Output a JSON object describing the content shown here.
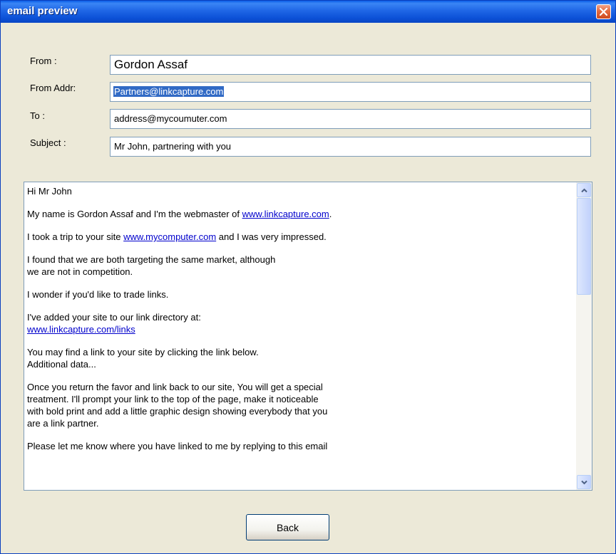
{
  "window": {
    "title": "email preview"
  },
  "form": {
    "from_label": "From :",
    "from_value": "Gordon Assaf",
    "from_addr_label": "From Addr:",
    "from_addr_value": "Partners@linkcapture.com",
    "to_label": "To :",
    "to_value": "address@mycoumuter.com",
    "subject_label": "Subject :",
    "subject_value": "Mr John, partnering with you"
  },
  "body": {
    "greeting": "Hi Mr John",
    "p1_before": "My name is Gordon Assaf and I'm the webmaster of ",
    "p1_link": "www.linkcapture.com",
    "p1_after": ".",
    "p2_before": "I took a trip to your site ",
    "p2_link": "www.mycomputer.com",
    "p2_after": " and I was very impressed.",
    "p3": "I found that we are both targeting the same market, although\nwe are not in competition.",
    "p4": "I wonder if you'd like to trade links.",
    "p5_text": "I've added your site to our link directory at:",
    "p5_link": "www.linkcapture.com/links",
    "p6": "You may find a link to your site by clicking the link below.\nAdditional data...",
    "p7": "Once you return the favor and link back to our site, You will get a special\ntreatment.  I'll prompt your link to the top of the page, make it noticeable\nwith bold print and add a little graphic design showing everybody that you\nare a link partner.",
    "p8": "Please let me know where you have linked to me by replying to this email"
  },
  "buttons": {
    "back_label": "Back"
  },
  "colors": {
    "titlebar": "#0b50d6",
    "window_bg": "#ece9d8",
    "link": "#0000cc",
    "selection": "#316ac5"
  }
}
